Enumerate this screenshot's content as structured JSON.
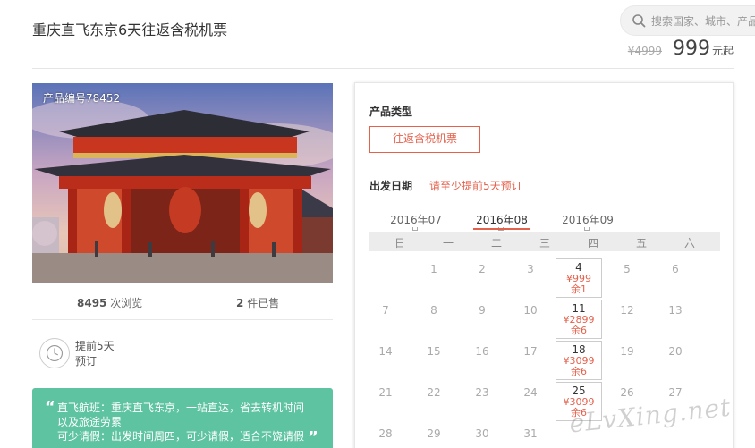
{
  "product": {
    "title": "重庆直飞东京6天往返含税机票",
    "photo_code": "产品编号78452"
  },
  "search": {
    "placeholder": "搜索国家、城市、产品"
  },
  "price": {
    "original": "¥4999",
    "current": "999",
    "unit": "元起"
  },
  "stats": {
    "views_num": "8495",
    "views_label": "次浏览",
    "sold_num": "2",
    "sold_label": "件已售"
  },
  "advance": {
    "line1": "提前5天",
    "line2": "预订"
  },
  "quote": {
    "open": "“",
    "close": "”",
    "lines": [
      "直飞航班：重庆直飞东京，一站直达，省去转机时间",
      "以及旅途劳累",
      "可少请假：出发时间周四，可少请假，适合不饶请假"
    ]
  },
  "booking": {
    "type_label": "产品类型",
    "type_option": "往返含税机票",
    "date_label": "出发日期",
    "date_hint": "请至少提前5天预订",
    "months": [
      "2016年07",
      "2016年08",
      "2016年09"
    ],
    "active_month": "2016年08",
    "weekdays": [
      "日",
      "一",
      "二",
      "三",
      "四",
      "五",
      "六"
    ],
    "days": [
      [
        "",
        "1",
        "2",
        "3",
        "4",
        "5",
        "6"
      ],
      [
        "7",
        "8",
        "9",
        "10",
        "11",
        "12",
        "13"
      ],
      [
        "14",
        "15",
        "16",
        "17",
        "18",
        "19",
        "20"
      ],
      [
        "21",
        "22",
        "23",
        "24",
        "25",
        "26",
        "27"
      ],
      [
        "28",
        "29",
        "30",
        "31",
        "",
        "",
        ""
      ]
    ],
    "available": [
      {
        "day": "4",
        "price": "¥999",
        "stock": "余1"
      },
      {
        "day": "11",
        "price": "¥2899",
        "stock": "余6"
      },
      {
        "day": "18",
        "price": "¥3099",
        "stock": "余6"
      },
      {
        "day": "25",
        "price": "¥3099",
        "stock": "余6"
      }
    ]
  },
  "watermark": "eLvXing.net",
  "colors": {
    "accent": "#e4614c",
    "quote_bg": "#5ec3a0"
  }
}
